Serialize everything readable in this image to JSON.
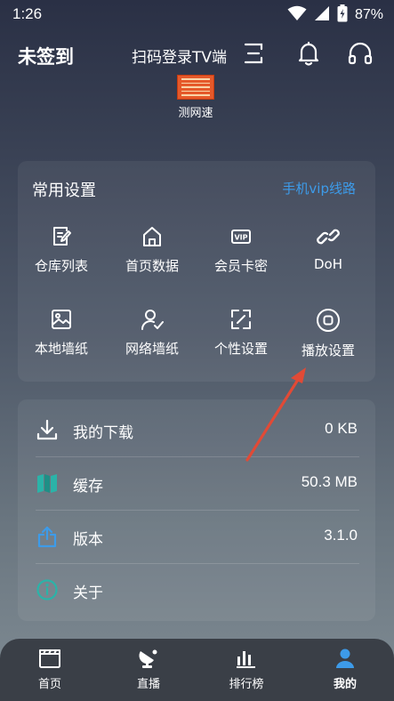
{
  "status": {
    "time": "1:26",
    "battery": "87%"
  },
  "header": {
    "signin_label": "未签到",
    "scan_label": "扫码登录TV端"
  },
  "speed_test": {
    "label": "测网速"
  },
  "settings": {
    "title": "常用设置",
    "link": "手机vip线路",
    "items": [
      {
        "label": "仓库列表",
        "icon": "document-edit-icon"
      },
      {
        "label": "首页数据",
        "icon": "home-icon"
      },
      {
        "label": "会员卡密",
        "icon": "vip-icon"
      },
      {
        "label": "DoH",
        "icon": "link-icon"
      },
      {
        "label": "本地墙纸",
        "icon": "image-icon"
      },
      {
        "label": "网络墙纸",
        "icon": "user-check-icon"
      },
      {
        "label": "个性设置",
        "icon": "expand-icon"
      },
      {
        "label": "播放设置",
        "icon": "stop-circle-icon"
      }
    ]
  },
  "info": {
    "rows": [
      {
        "label": "我的下载",
        "value": "0 KB",
        "icon": "download-icon"
      },
      {
        "label": "缓存",
        "value": "50.3 MB",
        "icon": "map-icon"
      },
      {
        "label": "版本",
        "value": "3.1.0",
        "icon": "share-icon"
      },
      {
        "label": "关于",
        "value": "",
        "icon": "info-icon"
      }
    ]
  },
  "nav": {
    "items": [
      {
        "label": "首页",
        "icon": "clapperboard-icon"
      },
      {
        "label": "直播",
        "icon": "live-dish-icon"
      },
      {
        "label": "排行榜",
        "icon": "bar-chart-icon"
      },
      {
        "label": "我的",
        "icon": "user-icon"
      }
    ]
  },
  "colors": {
    "accent": "#3d9be9",
    "arrow": "#e14a36",
    "teal": "#2bb3a8",
    "nav_bg": "#3a3f47"
  }
}
